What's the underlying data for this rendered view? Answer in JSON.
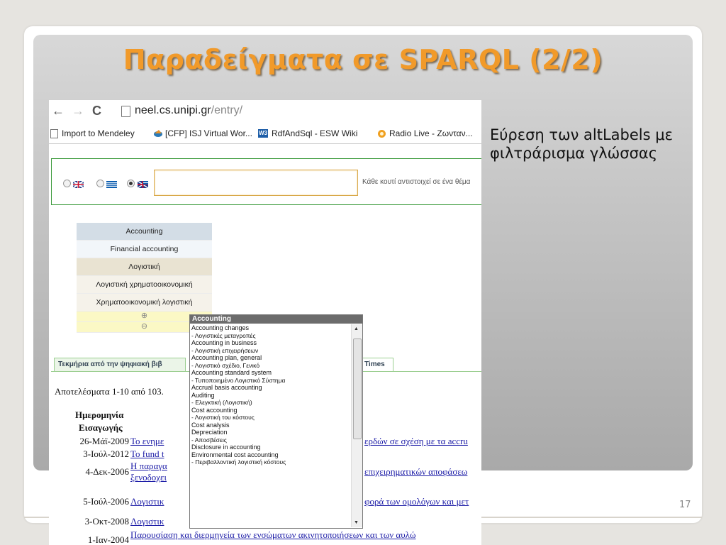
{
  "slide": {
    "title": "Παραδείγματα σε SPARQL (2/2)",
    "side_text": "Εύρεση των altLabels με φιλτράρισμα γλώσσας",
    "page_number": "17"
  },
  "browser": {
    "url_host": "neel.cs.unipi.gr",
    "url_path": "/entry/",
    "bookmarks": [
      "Import to Mendeley",
      "[CFP] ISJ Virtual Wor...",
      "RdfAndSql - ESW Wiki",
      "Radio Live - Ζωνταν..."
    ],
    "bookmark_icon_text": "W3"
  },
  "search": {
    "hint": "Κάθε κουτί αντιστοιχεί σε ένα θέμα",
    "input_value": ""
  },
  "tree": {
    "rows": [
      "Accounting",
      "Financial accounting",
      "Λογιστική",
      "Λογιστική χρηματοοικονομική",
      "Χρηματοοικονομική λογιστική"
    ],
    "zoom_in": "⊕",
    "zoom_out": "⊖"
  },
  "dropdown": {
    "title": "Accounting",
    "items": [
      {
        "en": "Accounting changes",
        "gr": "- Λογιστικές μεταγροπές"
      },
      {
        "en": "Accounting in business",
        "gr": "- Λογιστική επιχειρήσεων"
      },
      {
        "en": "Accounting plan, general",
        "gr": "- Λογιστικό σχέδιο, Γενικό"
      },
      {
        "en": "Accounting standard system",
        "gr": "- Τυποποιημένο Λογιστικό Σύστημα"
      },
      {
        "en": "Accrual basis accounting",
        "gr": ""
      },
      {
        "en": "Auditing",
        "gr": "- Ελεγκτική (Λογιστική)"
      },
      {
        "en": "Cost accounting",
        "gr": "- Λογιστική του κόστους"
      },
      {
        "en": "Cost analysis",
        "gr": ""
      },
      {
        "en": "Depreciation",
        "gr": "- Αποσβέσεις"
      },
      {
        "en": "Disclosure in accounting",
        "gr": ""
      },
      {
        "en": "Environmental cost accounting",
        "gr": "- Περιβαλλοντική λογιστική κόστους"
      }
    ]
  },
  "tabs": {
    "left": "Τεκμήρια από την ψηφιακή βιβ",
    "right": "Times"
  },
  "results": {
    "summary": "Αποτελέσματα 1-10 από 103.",
    "col_header_1": "Ημερομηνία",
    "col_header_2": "Εισαγωγής",
    "rows": [
      {
        "date": "26-Μάϊ-2009",
        "left": "Το ενημε",
        "right": "ερδών σε σχέση με τα accru"
      },
      {
        "date": "3-Ιούλ-2012",
        "left": "To fund t",
        "right": ""
      },
      {
        "date": "4-Δεκ-2006",
        "left": "Η παραγα",
        "left2": "ξενοδοχει",
        "right": "επιχειρηματικών αποφάσεω"
      },
      {
        "date": "5-Ιούλ-2006",
        "left": "Λογιστικ",
        "right": "φορά των ομολόγων και μετ"
      },
      {
        "date": "3-Οκτ-2008",
        "left": "Λογιστικ",
        "right": ""
      },
      {
        "date": "1-Ιαν-2004",
        "left": "Παρουσίαση και διερμηνεία των ενσώματων ακινητοποιήσεων και των αυλώ",
        "right": ""
      }
    ]
  }
}
